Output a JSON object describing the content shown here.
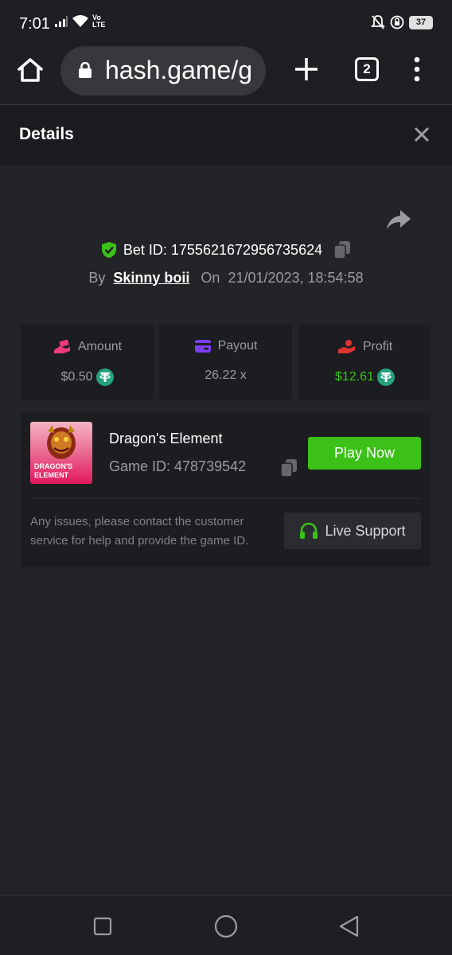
{
  "status_bar": {
    "time": "7:01",
    "volte": "Vo\nLTE",
    "battery": "37"
  },
  "browser": {
    "url": "hash.game/g",
    "tab_count": "2"
  },
  "details": {
    "title": "Details"
  },
  "bet": {
    "bet_id": "Bet ID: 1755621672956735624",
    "by_label": "By",
    "username": "Skinny boii",
    "on_label": "On",
    "datetime": "21/01/2023, 18:54:58"
  },
  "stats": {
    "amount_label": "Amount",
    "amount_value": "$0.50",
    "payout_label": "Payout",
    "payout_value": "26.22 x",
    "profit_label": "Profit",
    "profit_value": "$12.61"
  },
  "game": {
    "name": "Dragon's Element",
    "game_id": "Game ID: 478739542",
    "thumb_line1": "DRAGON'S",
    "thumb_line2": "ELEMENT",
    "play_label": "Play Now",
    "issue_text": "Any issues, please contact the customer service for help and provide the game ID.",
    "support_label": "Live Support"
  },
  "colors": {
    "accent_green": "#3bc117",
    "background": "#232427",
    "card": "#1c1d20",
    "tether": "#26a17b"
  }
}
